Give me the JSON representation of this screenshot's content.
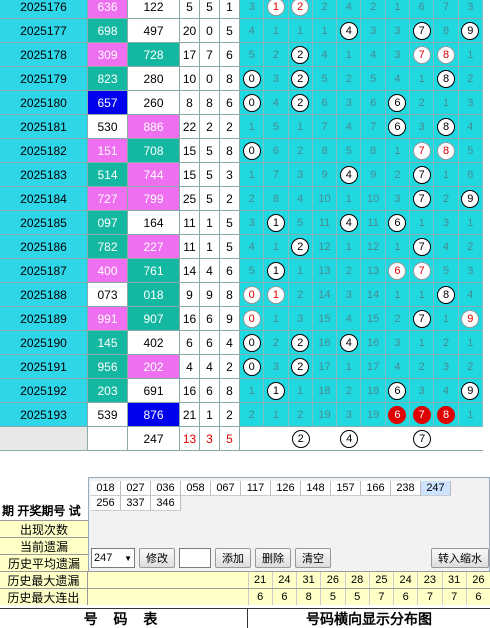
{
  "rows": [
    {
      "period": "2025176",
      "p3": "636",
      "p3c": "pink",
      "g3": "122",
      "g3c": "white",
      "a": "5",
      "b": "5",
      "c": "1",
      "d": [
        {
          "v": "3"
        },
        {
          "v": "1",
          "ball": "red"
        },
        {
          "v": "2",
          "ball": "red"
        },
        {
          "v": "2"
        },
        {
          "v": "4"
        },
        {
          "v": "2"
        },
        {
          "v": "1"
        },
        {
          "v": "6"
        },
        {
          "v": "7"
        },
        {
          "v": "3"
        }
      ]
    },
    {
      "period": "2025177",
      "p3": "698",
      "p3c": "teal",
      "g3": "497",
      "g3c": "white",
      "a": "20",
      "b": "0",
      "c": "5",
      "d": [
        {
          "v": "4"
        },
        {
          "v": "1"
        },
        {
          "v": "1"
        },
        {
          "v": "1"
        },
        {
          "v": "4",
          "ball": "plain"
        },
        {
          "v": "3"
        },
        {
          "v": "3"
        },
        {
          "v": "7",
          "ball": "plain"
        },
        {
          "v": "8"
        },
        {
          "v": "9",
          "ball": "plain"
        }
      ]
    },
    {
      "period": "2025178",
      "p3": "309",
      "p3c": "pink",
      "g3": "728",
      "g3c": "teal",
      "a": "17",
      "b": "7",
      "c": "6",
      "d": [
        {
          "v": "5"
        },
        {
          "v": "2"
        },
        {
          "v": "2",
          "ball": "plain"
        },
        {
          "v": "4"
        },
        {
          "v": "1"
        },
        {
          "v": "4"
        },
        {
          "v": "3"
        },
        {
          "v": "7",
          "ball": "red"
        },
        {
          "v": "8",
          "ball": "red"
        },
        {
          "v": "1"
        }
      ]
    },
    {
      "period": "2025179",
      "p3": "823",
      "p3c": "teal",
      "g3": "280",
      "g3c": "white",
      "a": "10",
      "b": "0",
      "c": "8",
      "d": [
        {
          "v": "0",
          "ball": "plain"
        },
        {
          "v": "3"
        },
        {
          "v": "2",
          "ball": "plain"
        },
        {
          "v": "5"
        },
        {
          "v": "2"
        },
        {
          "v": "5"
        },
        {
          "v": "4"
        },
        {
          "v": "1"
        },
        {
          "v": "8",
          "ball": "plain"
        },
        {
          "v": "2"
        }
      ]
    },
    {
      "period": "2025180",
      "p3": "657",
      "p3c": "blue",
      "g3": "260",
      "g3c": "white",
      "a": "8",
      "b": "8",
      "c": "6",
      "d": [
        {
          "v": "0",
          "ball": "plain"
        },
        {
          "v": "4"
        },
        {
          "v": "2",
          "ball": "plain"
        },
        {
          "v": "6"
        },
        {
          "v": "3"
        },
        {
          "v": "6"
        },
        {
          "v": "6",
          "ball": "plain"
        },
        {
          "v": "2"
        },
        {
          "v": "1"
        },
        {
          "v": "3"
        }
      ]
    },
    {
      "period": "2025181",
      "p3": "530",
      "p3c": "white",
      "g3": "886",
      "g3c": "pink",
      "a": "22",
      "b": "2",
      "c": "2",
      "d": [
        {
          "v": "1"
        },
        {
          "v": "5"
        },
        {
          "v": "1"
        },
        {
          "v": "7"
        },
        {
          "v": "4"
        },
        {
          "v": "7"
        },
        {
          "v": "6",
          "ball": "plain"
        },
        {
          "v": "3"
        },
        {
          "v": "8",
          "ball": "plain"
        },
        {
          "v": "4"
        }
      ]
    },
    {
      "period": "2025182",
      "p3": "151",
      "p3c": "pink",
      "g3": "708",
      "g3c": "teal",
      "a": "15",
      "b": "5",
      "c": "8",
      "d": [
        {
          "v": "0",
          "ball": "plain"
        },
        {
          "v": "6"
        },
        {
          "v": "2"
        },
        {
          "v": "8"
        },
        {
          "v": "5"
        },
        {
          "v": "8"
        },
        {
          "v": "1"
        },
        {
          "v": "7",
          "ball": "red"
        },
        {
          "v": "8",
          "ball": "red"
        },
        {
          "v": "5"
        }
      ]
    },
    {
      "period": "2025183",
      "p3": "514",
      "p3c": "teal",
      "g3": "744",
      "g3c": "pink",
      "a": "15",
      "b": "5",
      "c": "3",
      "d": [
        {
          "v": "1"
        },
        {
          "v": "7"
        },
        {
          "v": "3"
        },
        {
          "v": "9"
        },
        {
          "v": "4",
          "ball": "plain"
        },
        {
          "v": "9"
        },
        {
          "v": "2"
        },
        {
          "v": "7",
          "ball": "plain"
        },
        {
          "v": "1"
        },
        {
          "v": "6"
        }
      ]
    },
    {
      "period": "2025184",
      "p3": "727",
      "p3c": "pink",
      "g3": "799",
      "g3c": "pink",
      "a": "25",
      "b": "5",
      "c": "2",
      "d": [
        {
          "v": "2"
        },
        {
          "v": "8"
        },
        {
          "v": "4"
        },
        {
          "v": "10"
        },
        {
          "v": "1"
        },
        {
          "v": "10"
        },
        {
          "v": "3"
        },
        {
          "v": "7",
          "ball": "plain"
        },
        {
          "v": "2"
        },
        {
          "v": "9",
          "ball": "plain"
        }
      ]
    },
    {
      "period": "2025185",
      "p3": "097",
      "p3c": "teal",
      "g3": "164",
      "g3c": "white",
      "a": "11",
      "b": "1",
      "c": "5",
      "d": [
        {
          "v": "3"
        },
        {
          "v": "1",
          "ball": "plain"
        },
        {
          "v": "5"
        },
        {
          "v": "11"
        },
        {
          "v": "4",
          "ball": "plain"
        },
        {
          "v": "11"
        },
        {
          "v": "6",
          "ball": "plain"
        },
        {
          "v": "1"
        },
        {
          "v": "3"
        },
        {
          "v": "1"
        }
      ]
    },
    {
      "period": "2025186",
      "p3": "782",
      "p3c": "teal",
      "g3": "227",
      "g3c": "pink",
      "a": "11",
      "b": "1",
      "c": "5",
      "d": [
        {
          "v": "4"
        },
        {
          "v": "1"
        },
        {
          "v": "2",
          "ball": "plain"
        },
        {
          "v": "12"
        },
        {
          "v": "1"
        },
        {
          "v": "12"
        },
        {
          "v": "1"
        },
        {
          "v": "7",
          "ball": "plain"
        },
        {
          "v": "4"
        },
        {
          "v": "2"
        }
      ]
    },
    {
      "period": "2025187",
      "p3": "400",
      "p3c": "pink",
      "g3": "761",
      "g3c": "teal",
      "a": "14",
      "b": "4",
      "c": "6",
      "d": [
        {
          "v": "5"
        },
        {
          "v": "1",
          "ball": "plain"
        },
        {
          "v": "1"
        },
        {
          "v": "13"
        },
        {
          "v": "2"
        },
        {
          "v": "13"
        },
        {
          "v": "6",
          "ball": "red"
        },
        {
          "v": "7",
          "ball": "red"
        },
        {
          "v": "5"
        },
        {
          "v": "3"
        }
      ]
    },
    {
      "period": "2025188",
      "p3": "073",
      "p3c": "white",
      "g3": "018",
      "g3c": "teal",
      "a": "9",
      "b": "9",
      "c": "8",
      "d": [
        {
          "v": "0",
          "ball": "red"
        },
        {
          "v": "1",
          "ball": "red"
        },
        {
          "v": "2"
        },
        {
          "v": "14"
        },
        {
          "v": "3"
        },
        {
          "v": "14"
        },
        {
          "v": "1"
        },
        {
          "v": "1"
        },
        {
          "v": "8",
          "ball": "plain"
        },
        {
          "v": "4"
        }
      ]
    },
    {
      "period": "2025189",
      "p3": "991",
      "p3c": "pink",
      "g3": "907",
      "g3c": "teal",
      "a": "16",
      "b": "6",
      "c": "9",
      "d": [
        {
          "v": "0",
          "ball": "red"
        },
        {
          "v": "1"
        },
        {
          "v": "3"
        },
        {
          "v": "15"
        },
        {
          "v": "4"
        },
        {
          "v": "15"
        },
        {
          "v": "2"
        },
        {
          "v": "7",
          "ball": "plain"
        },
        {
          "v": "1"
        },
        {
          "v": "9",
          "ball": "red"
        }
      ]
    },
    {
      "period": "2025190",
      "p3": "145",
      "p3c": "teal",
      "g3": "402",
      "g3c": "white",
      "a": "6",
      "b": "6",
      "c": "4",
      "d": [
        {
          "v": "0",
          "ball": "plain"
        },
        {
          "v": "2"
        },
        {
          "v": "2",
          "ball": "plain"
        },
        {
          "v": "16"
        },
        {
          "v": "4",
          "ball": "plain"
        },
        {
          "v": "16"
        },
        {
          "v": "3"
        },
        {
          "v": "1"
        },
        {
          "v": "2"
        },
        {
          "v": "1"
        }
      ]
    },
    {
      "period": "2025191",
      "p3": "956",
      "p3c": "teal",
      "g3": "202",
      "g3c": "pink",
      "a": "4",
      "b": "4",
      "c": "2",
      "d": [
        {
          "v": "0",
          "ball": "plain"
        },
        {
          "v": "3"
        },
        {
          "v": "2",
          "ball": "plain"
        },
        {
          "v": "17"
        },
        {
          "v": "1"
        },
        {
          "v": "17"
        },
        {
          "v": "4"
        },
        {
          "v": "2"
        },
        {
          "v": "3"
        },
        {
          "v": "2"
        }
      ]
    },
    {
      "period": "2025192",
      "p3": "203",
      "p3c": "teal",
      "g3": "691",
      "g3c": "white",
      "a": "16",
      "b": "6",
      "c": "8",
      "d": [
        {
          "v": "1"
        },
        {
          "v": "1",
          "ball": "plain"
        },
        {
          "v": "1"
        },
        {
          "v": "18"
        },
        {
          "v": "2"
        },
        {
          "v": "18"
        },
        {
          "v": "6",
          "ball": "plain"
        },
        {
          "v": "3"
        },
        {
          "v": "4"
        },
        {
          "v": "9",
          "ball": "plain"
        }
      ]
    },
    {
      "period": "2025193",
      "p3": "539",
      "p3c": "white",
      "g3": "876",
      "g3c": "blue",
      "a": "21",
      "b": "1",
      "c": "2",
      "d": [
        {
          "v": "2"
        },
        {
          "v": "1"
        },
        {
          "v": "2"
        },
        {
          "v": "19"
        },
        {
          "v": "3"
        },
        {
          "v": "19"
        },
        {
          "v": "6",
          "ball": "solid"
        },
        {
          "v": "7",
          "ball": "solid"
        },
        {
          "v": "8",
          "ball": "solid"
        },
        {
          "v": "1"
        }
      ]
    }
  ],
  "pred_row": {
    "g3": "247",
    "a": "13",
    "b": "3",
    "c": "5",
    "balls": [
      "",
      "",
      "2",
      "",
      "4",
      "",
      "",
      "7",
      "",
      ""
    ]
  },
  "panel": {
    "row1": [
      "018",
      "027",
      "036",
      "058",
      "067",
      "117",
      "126",
      "148",
      "157",
      "166",
      "238",
      "247"
    ],
    "row2": [
      "256",
      "337",
      "346"
    ],
    "select_value": "247",
    "modify": "修改",
    "add": "添加",
    "delete": "删除",
    "clear": "清空",
    "import": "转入缩水"
  },
  "side": {
    "head": "期 开奖期号 试",
    "labels": [
      "出现次数",
      "当前遗漏",
      "历史平均遗漏"
    ]
  },
  "stats": [
    {
      "label": "历史最大遗漏",
      "values": [
        "21",
        "24",
        "31",
        "26",
        "28",
        "25",
        "24",
        "23",
        "31",
        "26"
      ]
    },
    {
      "label": "历史最大连出",
      "values": [
        "6",
        "6",
        "8",
        "5",
        "5",
        "7",
        "6",
        "7",
        "7",
        "6"
      ]
    }
  ],
  "footer": {
    "left": "号 码 表",
    "right": "号码横向显示分布图"
  }
}
